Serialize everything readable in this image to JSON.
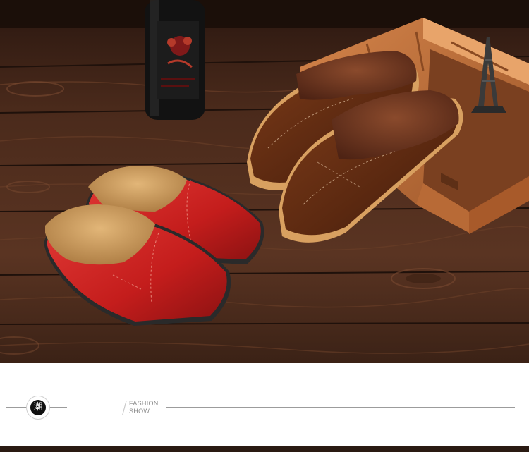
{
  "banner": {
    "seal_char": "潮",
    "title_line1": "FASHION",
    "title_line2": "SHOW"
  },
  "colors": {
    "wood_dark": "#3a2216",
    "wood_mid": "#5a3522",
    "red_leather": "#c8201f",
    "brown_leather": "#5b2a12",
    "fur_tan": "#c99a5a",
    "fur_brown": "#6a3320"
  }
}
